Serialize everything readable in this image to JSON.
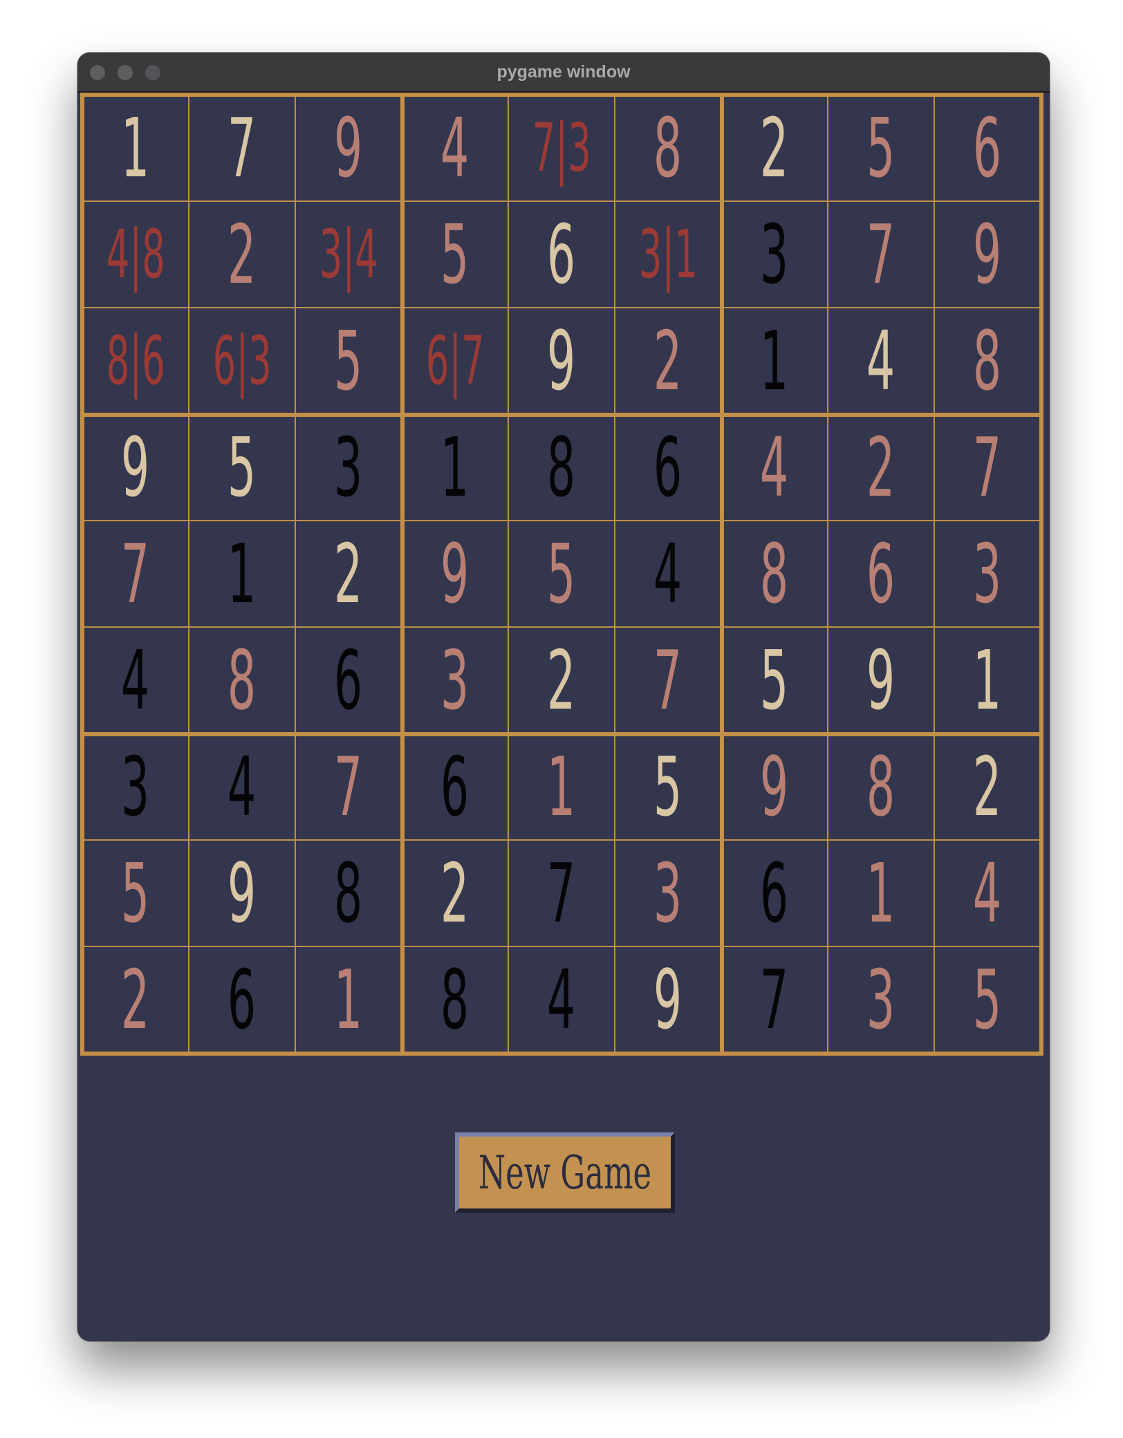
{
  "window": {
    "title": "pygame window"
  },
  "board": {
    "cells": [
      [
        {
          "t": "1",
          "k": "given-cream"
        },
        {
          "t": "7",
          "k": "given-cream"
        },
        {
          "t": "9",
          "k": "user"
        },
        {
          "t": "4",
          "k": "user"
        },
        {
          "t": "7|3",
          "k": "note"
        },
        {
          "t": "8",
          "k": "user"
        },
        {
          "t": "2",
          "k": "given-cream"
        },
        {
          "t": "5",
          "k": "user"
        },
        {
          "t": "6",
          "k": "user"
        }
      ],
      [
        {
          "t": "4|8",
          "k": "note"
        },
        {
          "t": "2",
          "k": "user"
        },
        {
          "t": "3|4",
          "k": "note"
        },
        {
          "t": "5",
          "k": "user"
        },
        {
          "t": "6",
          "k": "given-cream"
        },
        {
          "t": "3|1",
          "k": "note"
        },
        {
          "t": "3",
          "k": "given-black"
        },
        {
          "t": "7",
          "k": "user"
        },
        {
          "t": "9",
          "k": "user"
        }
      ],
      [
        {
          "t": "8|6",
          "k": "note"
        },
        {
          "t": "6|3",
          "k": "note"
        },
        {
          "t": "5",
          "k": "user"
        },
        {
          "t": "6|7",
          "k": "note"
        },
        {
          "t": "9",
          "k": "given-cream"
        },
        {
          "t": "2",
          "k": "user"
        },
        {
          "t": "1",
          "k": "given-black"
        },
        {
          "t": "4",
          "k": "given-cream"
        },
        {
          "t": "8",
          "k": "user"
        }
      ],
      [
        {
          "t": "9",
          "k": "given-cream"
        },
        {
          "t": "5",
          "k": "given-cream"
        },
        {
          "t": "3",
          "k": "given-black"
        },
        {
          "t": "1",
          "k": "given-black"
        },
        {
          "t": "8",
          "k": "given-black"
        },
        {
          "t": "6",
          "k": "given-black"
        },
        {
          "t": "4",
          "k": "user"
        },
        {
          "t": "2",
          "k": "user"
        },
        {
          "t": "7",
          "k": "user"
        }
      ],
      [
        {
          "t": "7",
          "k": "user"
        },
        {
          "t": "1",
          "k": "given-black"
        },
        {
          "t": "2",
          "k": "given-cream"
        },
        {
          "t": "9",
          "k": "user"
        },
        {
          "t": "5",
          "k": "user"
        },
        {
          "t": "4",
          "k": "given-black"
        },
        {
          "t": "8",
          "k": "user"
        },
        {
          "t": "6",
          "k": "user"
        },
        {
          "t": "3",
          "k": "user"
        }
      ],
      [
        {
          "t": "4",
          "k": "given-black"
        },
        {
          "t": "8",
          "k": "user"
        },
        {
          "t": "6",
          "k": "given-black"
        },
        {
          "t": "3",
          "k": "user"
        },
        {
          "t": "2",
          "k": "given-cream"
        },
        {
          "t": "7",
          "k": "user"
        },
        {
          "t": "5",
          "k": "given-cream"
        },
        {
          "t": "9",
          "k": "given-cream"
        },
        {
          "t": "1",
          "k": "given-cream"
        }
      ],
      [
        {
          "t": "3",
          "k": "given-black"
        },
        {
          "t": "4",
          "k": "given-black"
        },
        {
          "t": "7",
          "k": "user"
        },
        {
          "t": "6",
          "k": "given-black"
        },
        {
          "t": "1",
          "k": "user"
        },
        {
          "t": "5",
          "k": "given-cream"
        },
        {
          "t": "9",
          "k": "user"
        },
        {
          "t": "8",
          "k": "user"
        },
        {
          "t": "2",
          "k": "given-cream"
        }
      ],
      [
        {
          "t": "5",
          "k": "user"
        },
        {
          "t": "9",
          "k": "given-cream"
        },
        {
          "t": "8",
          "k": "given-black"
        },
        {
          "t": "2",
          "k": "given-cream"
        },
        {
          "t": "7",
          "k": "given-black"
        },
        {
          "t": "3",
          "k": "user"
        },
        {
          "t": "6",
          "k": "given-black"
        },
        {
          "t": "1",
          "k": "user"
        },
        {
          "t": "4",
          "k": "user"
        }
      ],
      [
        {
          "t": "2",
          "k": "user"
        },
        {
          "t": "6",
          "k": "given-black"
        },
        {
          "t": "1",
          "k": "user"
        },
        {
          "t": "8",
          "k": "given-black"
        },
        {
          "t": "4",
          "k": "given-black"
        },
        {
          "t": "9",
          "k": "given-cream"
        },
        {
          "t": "7",
          "k": "given-black"
        },
        {
          "t": "3",
          "k": "user"
        },
        {
          "t": "5",
          "k": "user"
        }
      ]
    ]
  },
  "buttons": {
    "new_game": "New Game"
  },
  "colors": {
    "background": "#34364d",
    "grid": "#c49048",
    "given_black": "#050508",
    "given_cream": "#d8c6a4",
    "user_entry": "#b87f74",
    "pencil_note": "#9c3a36",
    "button_face": "#c39250"
  }
}
